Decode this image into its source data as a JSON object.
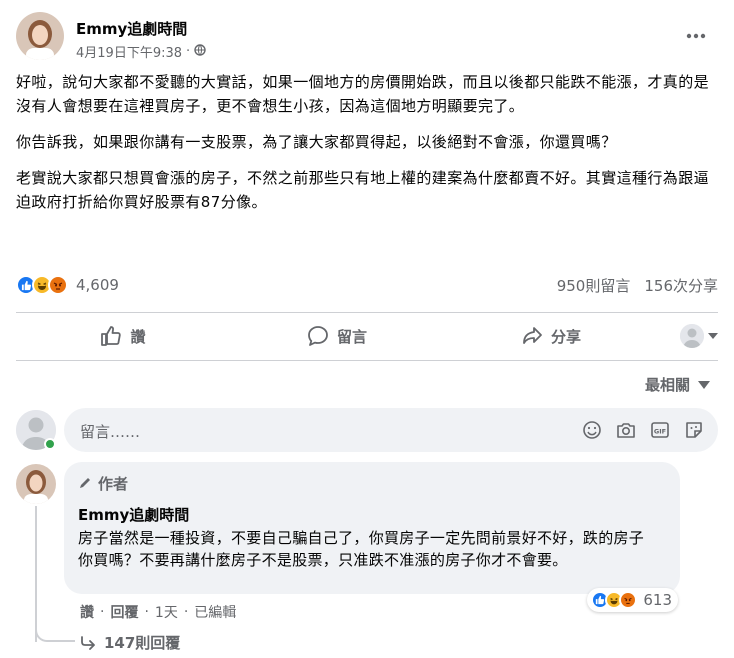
{
  "post": {
    "author": "Emmy追劇時間",
    "timestamp": "4月19日下午9:38",
    "privacy_icon": "globe-icon",
    "paragraphs": [
      "好啦，說句大家都不愛聽的大實話，如果一個地方的房價開始跌，而且以後都只能跌不能漲，才真的是沒有人會想要在這裡買房子，更不會想生小孩，因為這個地方明顯要完了。",
      "你告訴我，如果跟你講有一支股票，為了讓大家都買得起，以後絕對不會漲，你還買嗎？",
      "老實說大家都只想買會漲的房子，不然之前那些只有地上權的建案為什麼都賣不好。其實這種行為跟逼迫政府打折給你買好股票有87分像。"
    ]
  },
  "reactions": {
    "count": "4,609",
    "comments": "950則留言",
    "shares": "156次分享",
    "types": [
      "like",
      "haha",
      "angry"
    ]
  },
  "actions": {
    "like": "讚",
    "comment": "留言",
    "share": "分享"
  },
  "sort": {
    "label": "最相關"
  },
  "comment_input": {
    "placeholder": "留言……"
  },
  "top_comment": {
    "badge": "作者",
    "author": "Emmy追劇時間",
    "text": "房子當然是一種投資，不要自己騙自己了，你買房子一定先問前景好不好，跌的房子你買嗎？不要再講什麼房子不是股票，只准跌不准漲的房子你才不會要。",
    "like_label": "讚",
    "reply_label": "回覆",
    "age": "1天",
    "edited": "已編輯",
    "reaction_count": "613",
    "view_replies": "147則回覆"
  },
  "colors": {
    "like": "#1877f2",
    "haha": "#f7b928",
    "angry": "#e9710f",
    "secondary_text": "#65676b",
    "bubble": "#f0f2f5"
  }
}
